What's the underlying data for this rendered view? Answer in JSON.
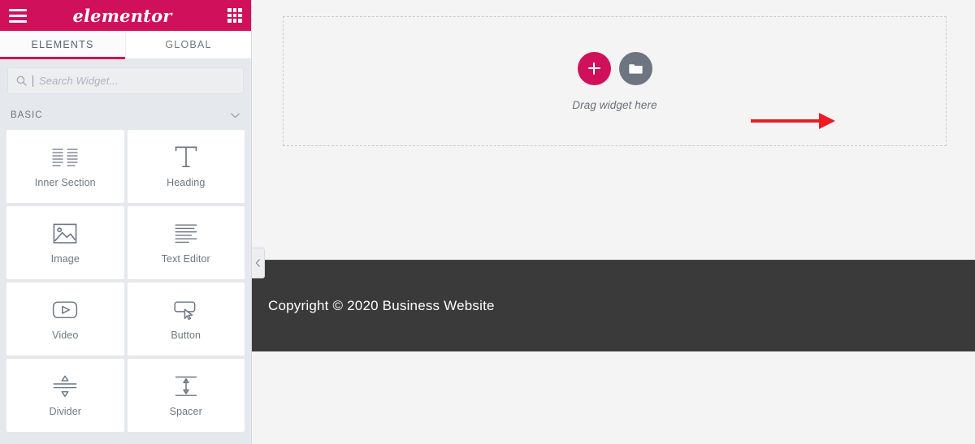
{
  "panel": {
    "brand": "elementor",
    "menu_icon": "hamburger-icon",
    "apps_icon": "grid-icon",
    "tabs": [
      {
        "label": "ELEMENTS",
        "active": true
      },
      {
        "label": "GLOBAL",
        "active": false
      }
    ],
    "search": {
      "placeholder": "Search Widget...",
      "value": "",
      "icon": "search-icon"
    },
    "category": {
      "label": "BASIC",
      "chevron": "chevron-down-icon",
      "expanded": true
    },
    "widgets": [
      {
        "label": "Inner Section",
        "icon": "inner-section-icon"
      },
      {
        "label": "Heading",
        "icon": "heading-icon"
      },
      {
        "label": "Image",
        "icon": "image-icon"
      },
      {
        "label": "Text Editor",
        "icon": "text-editor-icon"
      },
      {
        "label": "Video",
        "icon": "video-icon"
      },
      {
        "label": "Button",
        "icon": "button-icon"
      },
      {
        "label": "Divider",
        "icon": "divider-icon"
      },
      {
        "label": "Spacer",
        "icon": "spacer-icon"
      }
    ],
    "collapse_toggle": "chevron-left-icon"
  },
  "canvas": {
    "drop_zone": {
      "add_button_icon": "plus-icon",
      "template_button_icon": "folder-icon",
      "hint": "Drag widget here"
    },
    "footer": {
      "text": "Copyright © 2020 Business Website"
    },
    "annotation": {
      "type": "arrow",
      "color": "#ee1b24",
      "points_to": "add-section-button"
    }
  },
  "colors": {
    "brand_pink": "#d0105a",
    "accent_pink": "#d6176b",
    "panel_bg": "#e5e8ec",
    "canvas_bg": "#f4f4f4",
    "footer_bg": "#3a3a3a",
    "template_gray": "#6d7580",
    "annotation_red": "#ee1b24"
  }
}
